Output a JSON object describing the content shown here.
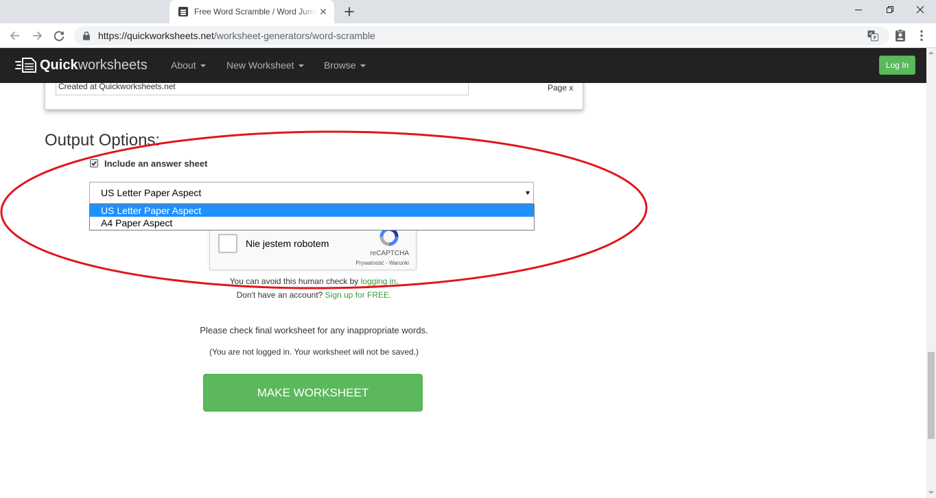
{
  "browser": {
    "tab_title": "Free Word Scramble / Word Jumb",
    "url_host": "https://quickworksheets.net",
    "url_path": "/worksheet-generators/word-scramble"
  },
  "site": {
    "logo_bold": "Quick",
    "logo_light": "worksheets",
    "nav": [
      {
        "label": "About"
      },
      {
        "label": "New Worksheet"
      },
      {
        "label": "Browse"
      }
    ],
    "login_label": "Log In"
  },
  "preview": {
    "footer_text": "Created at Quickworksheets.net",
    "page_label": "Page x"
  },
  "output_options": {
    "heading": "Output Options:",
    "answer_sheet_label": "Include an answer sheet",
    "answer_sheet_checked": true,
    "paper_select_value": "US Letter Paper Aspect",
    "paper_options": [
      "US Letter Paper Aspect",
      "A4 Paper Aspect"
    ],
    "highlighted_option": 0
  },
  "captcha": {
    "label": "Nie jestem robotem",
    "brand": "reCAPTCHA",
    "terms": "Prywatność - Warunki"
  },
  "human_check": {
    "line1_prefix": "You can avoid this human check by ",
    "line1_link": "logging in",
    "line1_suffix": ".",
    "line2_prefix": "Don't have an account? ",
    "line2_link": "Sign up for FREE."
  },
  "notices": {
    "inappropriate_words": "Please check final worksheet for any inappropriate words.",
    "not_saved": "(You are not logged in. Your worksheet will not be saved.)"
  },
  "make_button_label": "MAKE WORKSHEET",
  "colors": {
    "navbar": "#222222",
    "accent_green": "#5cb85c",
    "link_green": "#3a9a3a",
    "option_highlight": "#1e90ff",
    "annotation_red": "#e0161b"
  },
  "icons": [
    "back-arrow-icon",
    "forward-arrow-icon",
    "reload-icon",
    "lock-icon",
    "translate-icon",
    "profile-clipboard-icon",
    "menu-dots-icon",
    "logo-icon",
    "recaptcha-logo-icon",
    "checkmark-icon"
  ]
}
